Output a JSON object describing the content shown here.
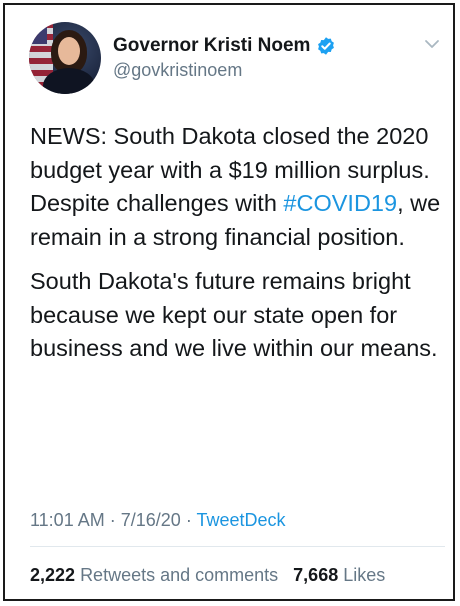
{
  "tweet": {
    "author_name": "Governor Kristi Noem",
    "handle": "@govkristinoem",
    "paragraph1_before": "NEWS: South Dakota closed the 2020 budget year with a $19 million surplus. Despite challenges with ",
    "hashtag": "#COVID19",
    "paragraph1_after": ", we remain in a strong financial position.",
    "paragraph2": "South Dakota's future remains bright because we kept our state open for business and we live within our means.",
    "time": "11:01 AM",
    "date": "7/16/20",
    "separator": "·",
    "source": "TweetDeck",
    "retweets_count": "2,222",
    "retweets_label": "Retweets and comments",
    "likes_count": "7,668",
    "likes_label": "Likes"
  },
  "colors": {
    "link": "#1b95e0",
    "secondary_text": "#657786",
    "verified": "#1da1f2"
  },
  "icons": [
    "verified-badge-icon",
    "chevron-down-icon"
  ]
}
